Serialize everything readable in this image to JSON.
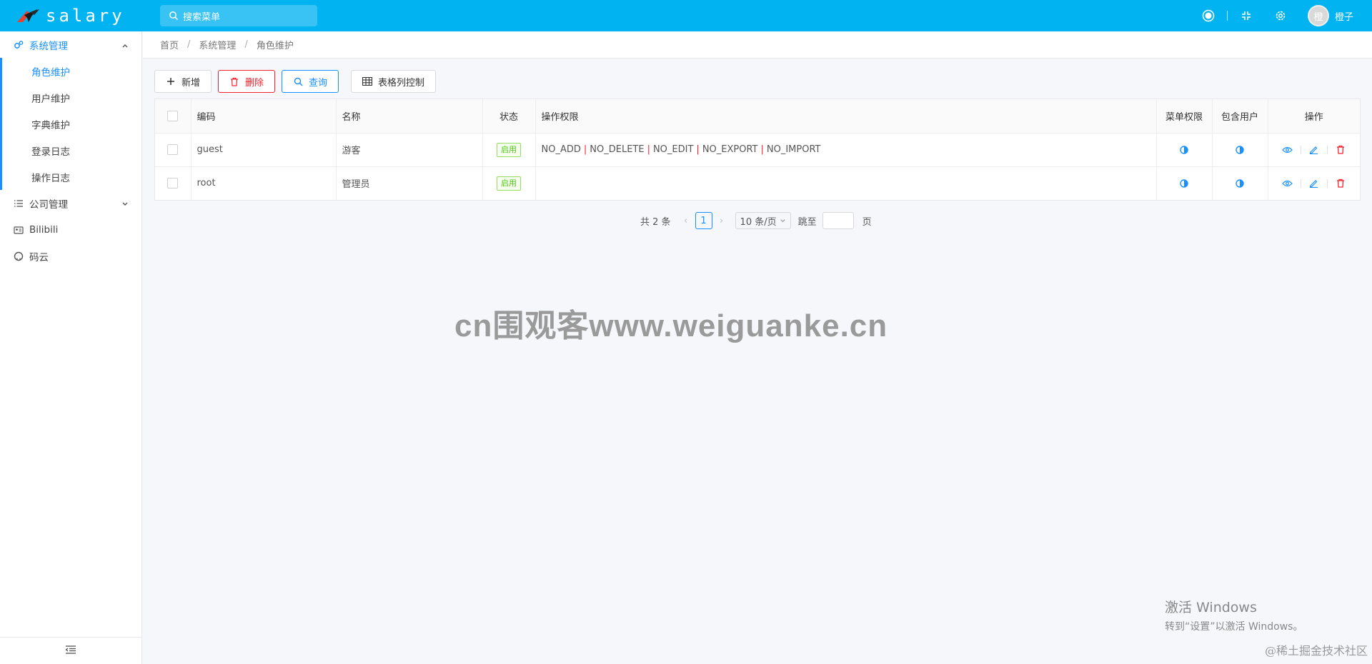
{
  "header": {
    "app_name": "salary",
    "search_placeholder": "搜索菜单",
    "avatar_char": "橙",
    "username": "橙子"
  },
  "sidebar": {
    "groups": [
      {
        "label": "系统管理",
        "icon": "gears-icon",
        "expanded": true,
        "items": [
          {
            "label": "角色维护",
            "active": true
          },
          {
            "label": "用户维护"
          },
          {
            "label": "字典维护"
          },
          {
            "label": "登录日志"
          },
          {
            "label": "操作日志"
          }
        ]
      },
      {
        "label": "公司管理",
        "icon": "list-icon",
        "expanded": false
      },
      {
        "label": "Bilibili",
        "icon": "idcard-icon"
      },
      {
        "label": "码云",
        "icon": "github-icon"
      }
    ]
  },
  "breadcrumb": [
    "首页",
    "系统管理",
    "角色维护"
  ],
  "toolbar": {
    "add_label": "新增",
    "delete_label": "删除",
    "query_label": "查询",
    "columns_label": "表格列控制"
  },
  "table": {
    "headers": {
      "code": "编码",
      "name": "名称",
      "status": "状态",
      "permissions": "操作权限",
      "menu_perm": "菜单权限",
      "users": "包含用户",
      "ops": "操作"
    },
    "rows": [
      {
        "code": "guest",
        "name": "游客",
        "status": "启用",
        "permissions": [
          "NO_ADD",
          "NO_DELETE",
          "NO_EDIT",
          "NO_EXPORT",
          "NO_IMPORT"
        ]
      },
      {
        "code": "root",
        "name": "管理员",
        "status": "启用",
        "permissions": []
      }
    ]
  },
  "pagination": {
    "total_text": "共 2 条",
    "current_page": "1",
    "page_size": "10 条/页",
    "jump_label": "跳至",
    "page_suffix": "页"
  },
  "overlays": {
    "watermark": "cn围观客www.weiguanke.cn",
    "win_title": "激活 Windows",
    "win_sub": "转到“设置”以激活 Windows。",
    "juejin": "@稀土掘金技术社区"
  },
  "colors": {
    "header_bg": "#01b3f1",
    "accent": "#1890ff",
    "danger": "#f5222d",
    "success": "#52c41a"
  }
}
